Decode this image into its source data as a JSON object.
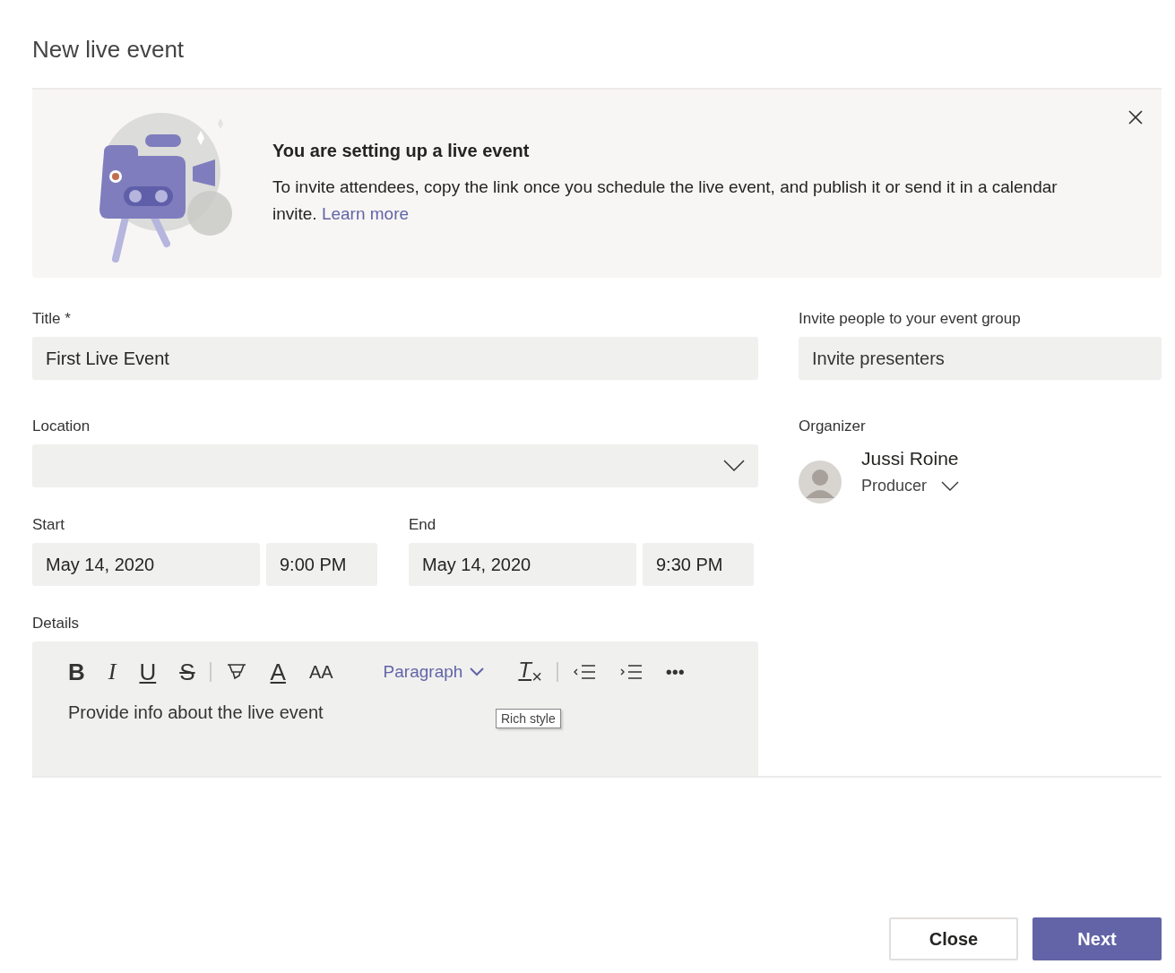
{
  "dialog": {
    "title": "New live event"
  },
  "banner": {
    "heading": "You are setting up a live event",
    "text": "To invite attendees, copy the link once you schedule the live event, and publish it or send it in a calendar invite.",
    "link": "Learn more"
  },
  "title_field": {
    "label": "Title *",
    "value": "First Live Event"
  },
  "location_field": {
    "label": "Location"
  },
  "start": {
    "label": "Start",
    "date": "May 14, 2020",
    "time": "9:00 PM"
  },
  "end": {
    "label": "End",
    "date": "May 14, 2020",
    "time": "9:30 PM"
  },
  "details": {
    "label": "Details",
    "placeholder": "Provide info about the live event",
    "tooltip": "Rich style",
    "toolbar": [
      {
        "kind": "bold",
        "label": "B"
      },
      {
        "kind": "italic",
        "label": "I"
      },
      {
        "kind": "underline",
        "label": "U"
      },
      {
        "kind": "strike",
        "label": "S"
      },
      {
        "kind": "divider"
      },
      {
        "kind": "highlighter"
      },
      {
        "kind": "font-color",
        "label": "A"
      },
      {
        "kind": "font-size",
        "label": "AA"
      },
      {
        "kind": "dropdown",
        "label": "Paragraph"
      },
      {
        "kind": "clear",
        "label": "T$_{×}$"
      },
      {
        "kind": "divider"
      },
      {
        "kind": "outdent"
      },
      {
        "kind": "indent"
      },
      {
        "kind": "more",
        "label": "•••"
      }
    ]
  },
  "invite": {
    "label": "Invite people to your event group",
    "placeholder": "Invite presenters"
  },
  "organizer": {
    "label": "Organizer",
    "name": "Jussi Roine",
    "role": "Producer"
  },
  "buttons": [
    {
      "label": "Close",
      "kind": "secondary"
    },
    {
      "label": "Next",
      "kind": "primary"
    }
  ]
}
